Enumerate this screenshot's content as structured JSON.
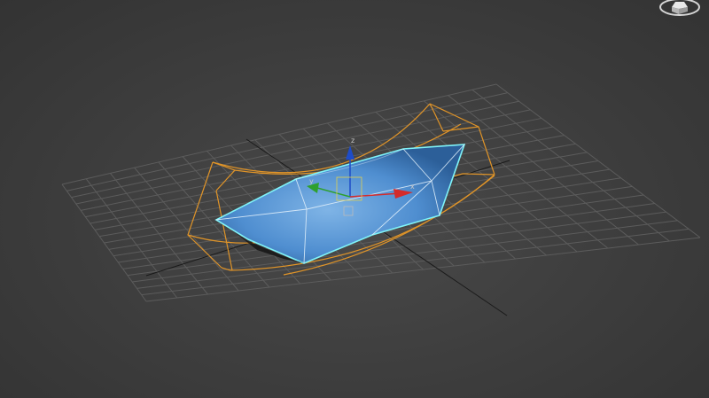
{
  "viewport": {
    "background": "#3f3f3f",
    "grid_color": "#5c5c5c",
    "grid_axis_color": "#1a1a1a"
  },
  "object": {
    "fill_color": "#4f8ed0",
    "selection_outline_color": "#7ff3f8",
    "edge_color": "#dfeefa"
  },
  "modifier_gizmo": {
    "color": "#e09428"
  },
  "transform_gizmo": {
    "x_label": "x",
    "y_label": "y",
    "z_label": "z",
    "x_color": "#d42b2b",
    "y_color": "#2ea02e",
    "z_color": "#1e4cc8"
  },
  "viewcube": {
    "icon": "viewcube-icon"
  }
}
